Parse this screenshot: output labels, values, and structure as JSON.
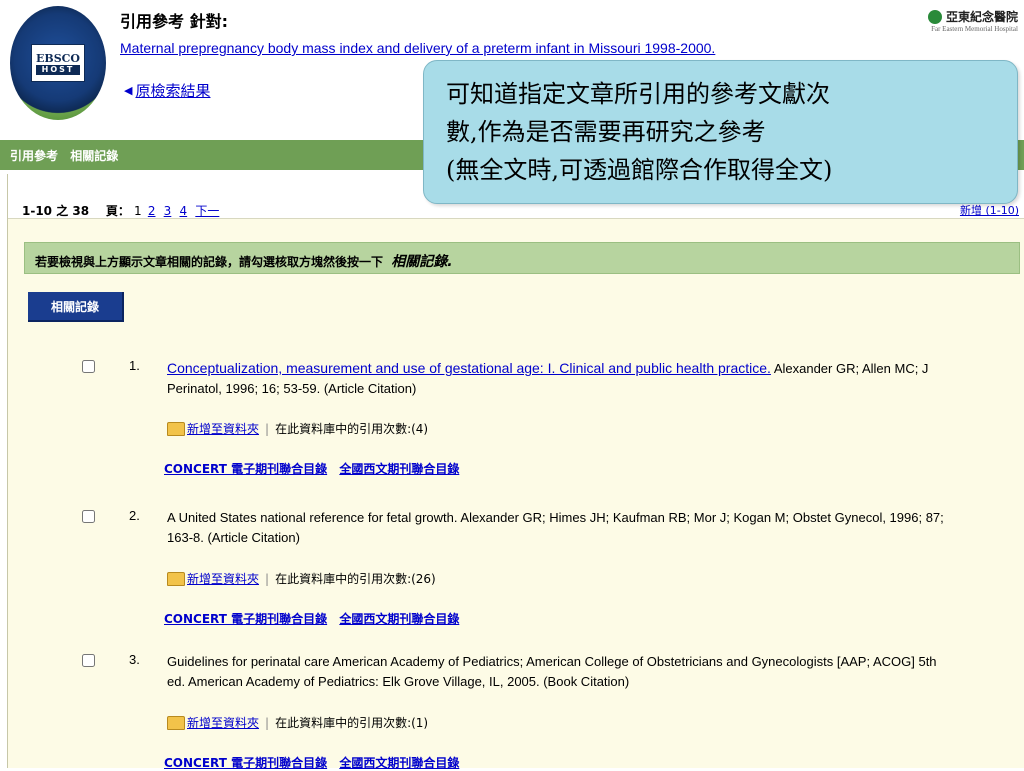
{
  "header": {
    "logo_top": "EBSCO",
    "logo_bottom": "HOST",
    "cite_heading": "引用參考 針對:",
    "article_title": "Maternal prepregnancy body mass index and delivery of a preterm infant in Missouri 1998-2000.",
    "back_link": "原檢索結果",
    "hospital_name": "亞東紀念醫院",
    "hospital_sub": "Far Eastern Memorial Hospital"
  },
  "nav": {
    "tabs": [
      "引用參考",
      "相關記錄"
    ]
  },
  "pager": {
    "range": "1-10 之 38",
    "page_label": "頁：",
    "current_page": "1",
    "pages": [
      "2",
      "3",
      "4"
    ],
    "next": "下一",
    "add_range": "新增 (1-10)"
  },
  "instruction": {
    "text": "若要檢視與上方顯示文章相關的記錄，請勾選核取方塊然後按一下",
    "emph": "相關記錄."
  },
  "related_button": "相關記錄",
  "entries": [
    {
      "num": "1.",
      "title": "Conceptualization, measurement and use of gestational age: I. Clinical and public health practice.",
      "citation": " Alexander GR; Allen MC; J Perinatol, 1996; 16; 53-59. (Article Citation)",
      "add_folder": "新增至資料夾",
      "cited_label": "在此資料庫中的引用次數:",
      "cited_count": "(4)",
      "link1": "CONCERT 電子期刊聯合目錄",
      "link2": "全國西文期刊聯合目錄"
    },
    {
      "num": "2.",
      "title": "",
      "citation": "A United States national reference for fetal growth. Alexander GR; Himes JH; Kaufman RB; Mor J; Kogan M; Obstet Gynecol, 1996; 87; 163-8. (Article Citation)",
      "add_folder": "新增至資料夾",
      "cited_label": "在此資料庫中的引用次數:",
      "cited_count": "(26)",
      "link1": "CONCERT 電子期刊聯合目錄",
      "link2": "全國西文期刊聯合目錄"
    },
    {
      "num": "3.",
      "title": "",
      "citation": "Guidelines for perinatal care American Academy of Pediatrics; American College of Obstetricians and Gynecologists [AAP; ACOG] 5th ed. American Academy of Pediatrics: Elk Grove Village, IL, 2005. (Book Citation)",
      "add_folder": "新增至資料夾",
      "cited_label": "在此資料庫中的引用次數:",
      "cited_count": "(1)",
      "link1": "CONCERT 電子期刊聯合目錄",
      "link2": "全國西文期刊聯合目錄"
    }
  ],
  "callout": {
    "line1": "可知道指定文章所引用的參考文獻次",
    "line2": "數,作為是否需要再研究之參考",
    "line3": "(無全文時,可透過館際合作取得全文)"
  },
  "colors": {
    "nav_green": "#6f9f55",
    "instr_green": "#b7d49f",
    "button_blue": "#1a3d8f",
    "panel_bg": "#fdfbe6",
    "callout_bg": "#a8dce8",
    "link": "#0000cc"
  }
}
